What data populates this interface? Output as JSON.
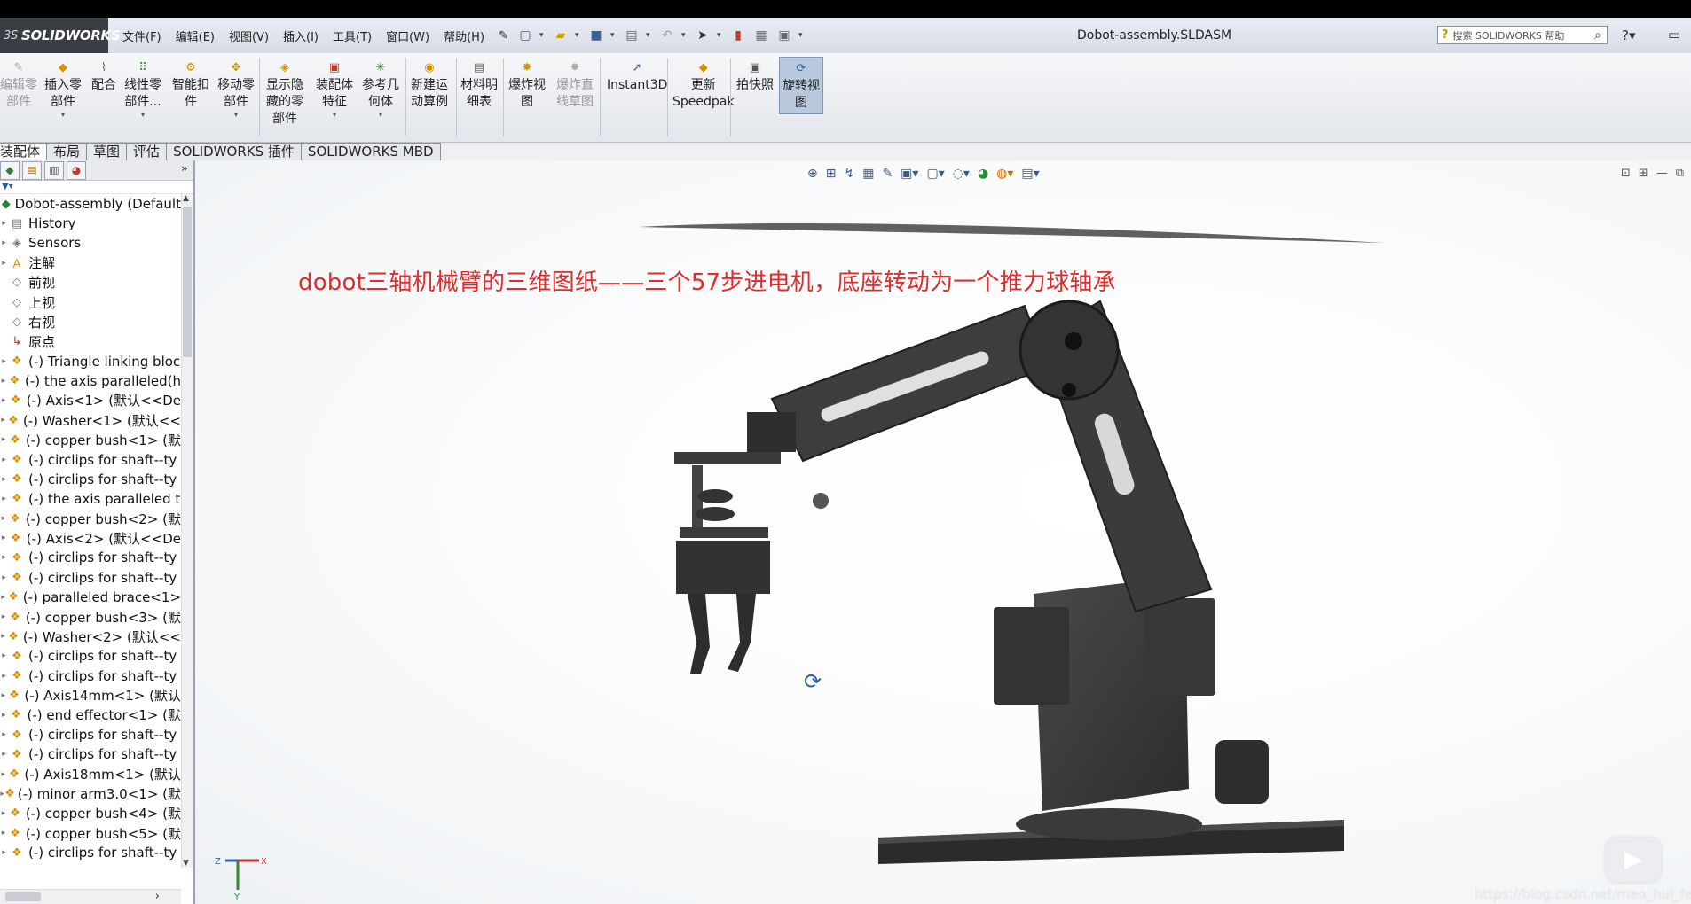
{
  "app": {
    "logo_text": "SOLIDWORKS",
    "logo_prefix": "3S",
    "document_title": "Dobot-assembly.SLDASM",
    "search_placeholder": "搜索 SOLIDWORKS 帮助"
  },
  "menu": [
    "文件(F)",
    "编辑(E)",
    "视图(V)",
    "插入(I)",
    "工具(T)",
    "窗口(W)",
    "帮助(H)"
  ],
  "ribbon": {
    "buttons": [
      {
        "l1": "编辑零",
        "l2": "部件",
        "disabled": true
      },
      {
        "l1": "插入零",
        "l2": "部件"
      },
      {
        "l1": "配合",
        "l2": ""
      },
      {
        "l1": "线性零",
        "l2": "部件..."
      },
      {
        "l1": "智能扣",
        "l2": "件"
      },
      {
        "l1": "移动零",
        "l2": "部件"
      },
      {
        "l1": "显示隐",
        "l2": "藏的零",
        "l3": "部件"
      },
      {
        "l1": "装配体",
        "l2": "特征"
      },
      {
        "l1": "参考几",
        "l2": "何体"
      },
      {
        "l1": "新建运",
        "l2": "动算例"
      },
      {
        "l1": "材料明",
        "l2": "细表"
      },
      {
        "l1": "爆炸视",
        "l2": "图"
      },
      {
        "l1": "爆炸直",
        "l2": "线草图",
        "disabled": true
      },
      {
        "l1": "Instant3D",
        "l2": ""
      },
      {
        "l1": "更新",
        "l2": "Speedpak"
      },
      {
        "l1": "拍快照",
        "l2": ""
      },
      {
        "l1": "旋转视",
        "l2": "图",
        "active": true
      }
    ]
  },
  "tabs": [
    "装配体",
    "布局",
    "草图",
    "评估",
    "SOLIDWORKS 插件",
    "SOLIDWORKS MBD"
  ],
  "feature_tree": {
    "root": "Dobot-assembly  (Default",
    "items": [
      {
        "icon": "history",
        "label": "History"
      },
      {
        "icon": "sensor",
        "label": "Sensors"
      },
      {
        "icon": "annotation",
        "label": "注解"
      },
      {
        "icon": "plane",
        "label": "前视"
      },
      {
        "icon": "plane",
        "label": "上视"
      },
      {
        "icon": "plane",
        "label": "右视"
      },
      {
        "icon": "origin",
        "label": "原点"
      },
      {
        "icon": "part",
        "label": "(-) Triangle linking bloc"
      },
      {
        "icon": "part",
        "label": "(-) the axis paralleled(h"
      },
      {
        "icon": "part",
        "label": "(-) Axis<1> (默认<<De"
      },
      {
        "icon": "part",
        "label": "(-) Washer<1> (默认<<"
      },
      {
        "icon": "part",
        "label": "(-) copper bush<1> (默"
      },
      {
        "icon": "part",
        "label": "(-) circlips for shaft--ty"
      },
      {
        "icon": "part",
        "label": "(-) circlips for shaft--ty"
      },
      {
        "icon": "part",
        "label": "(-) the axis paralleled t"
      },
      {
        "icon": "part",
        "label": "(-) copper bush<2> (默"
      },
      {
        "icon": "part",
        "label": "(-) Axis<2> (默认<<De"
      },
      {
        "icon": "part",
        "label": "(-) circlips for shaft--ty"
      },
      {
        "icon": "part",
        "label": "(-) circlips for shaft--ty"
      },
      {
        "icon": "part",
        "label": "(-) paralleled brace<1>"
      },
      {
        "icon": "part",
        "label": "(-) copper bush<3> (默"
      },
      {
        "icon": "part",
        "label": "(-) Washer<2> (默认<<"
      },
      {
        "icon": "part",
        "label": "(-) circlips for shaft--ty"
      },
      {
        "icon": "part",
        "label": "(-) circlips for shaft--ty"
      },
      {
        "icon": "part",
        "label": "(-) Axis14mm<1> (默认"
      },
      {
        "icon": "part",
        "label": "(-) end effector<1> (默"
      },
      {
        "icon": "part",
        "label": "(-) circlips for shaft--ty"
      },
      {
        "icon": "part",
        "label": "(-) circlips for shaft--ty"
      },
      {
        "icon": "part",
        "label": "(-) Axis18mm<1> (默认"
      },
      {
        "icon": "part",
        "label": "(-) minor arm3.0<1> (默"
      },
      {
        "icon": "part",
        "label": "(-) copper bush<4> (默"
      },
      {
        "icon": "part",
        "label": "(-) copper bush<5> (默"
      },
      {
        "icon": "part",
        "label": "(-) circlips for shaft--ty"
      }
    ]
  },
  "viewport": {
    "caption": "dobot三轴机械臂的三维图纸——三个57步进电机，底座转动为一个推力球轴承",
    "triad": {
      "x": "X",
      "y": "Y",
      "z": "Z"
    },
    "watermark": "https://blog.csdn.net/mao_hui_fei"
  },
  "colors": {
    "caption": "#e52a2a",
    "model": "#3a3a3a",
    "accent": "#2f63a8"
  }
}
